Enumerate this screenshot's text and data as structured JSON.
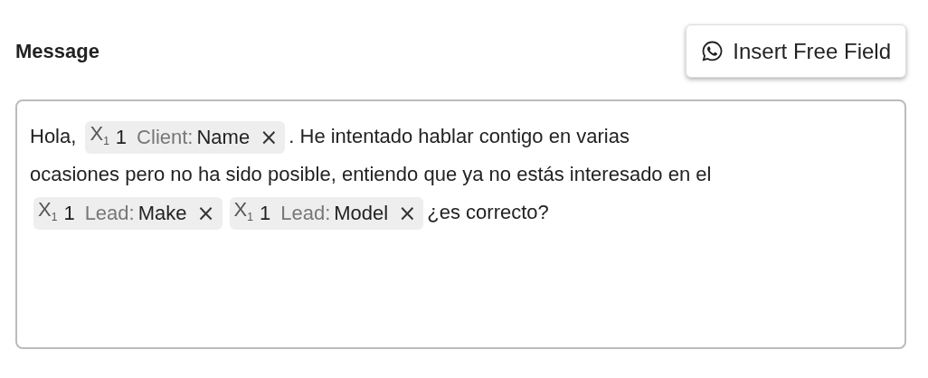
{
  "label": "Message",
  "insert_button": {
    "label": "Insert Free Field"
  },
  "message": {
    "segments": [
      {
        "kind": "text",
        "text": "Hola,"
      },
      {
        "kind": "field",
        "symbol": "X$_{1}$",
        "count": "1",
        "group": "Client:",
        "name": "Name",
        "remove": "×"
      },
      {
        "kind": "text",
        "text": ". He intentado hablar contigo en varias"
      },
      {
        "kind": "text",
        "text": "ocasiones pero no ha sido posible, entiendo que ya no estás interesado en"
      },
      {
        "kind": "text",
        "text": "el"
      },
      {
        "kind": "field",
        "symbol": "X$_{1}$",
        "count": "1",
        "group": "Lead:",
        "name": "Make",
        "remove": "×"
      },
      {
        "kind": "field",
        "symbol": "X$_{1}$",
        "count": "1",
        "group": "Lead:",
        "name": "Model",
        "remove": "×"
      },
      {
        "kind": "text",
        "text": "¿es correcto?"
      }
    ]
  }
}
